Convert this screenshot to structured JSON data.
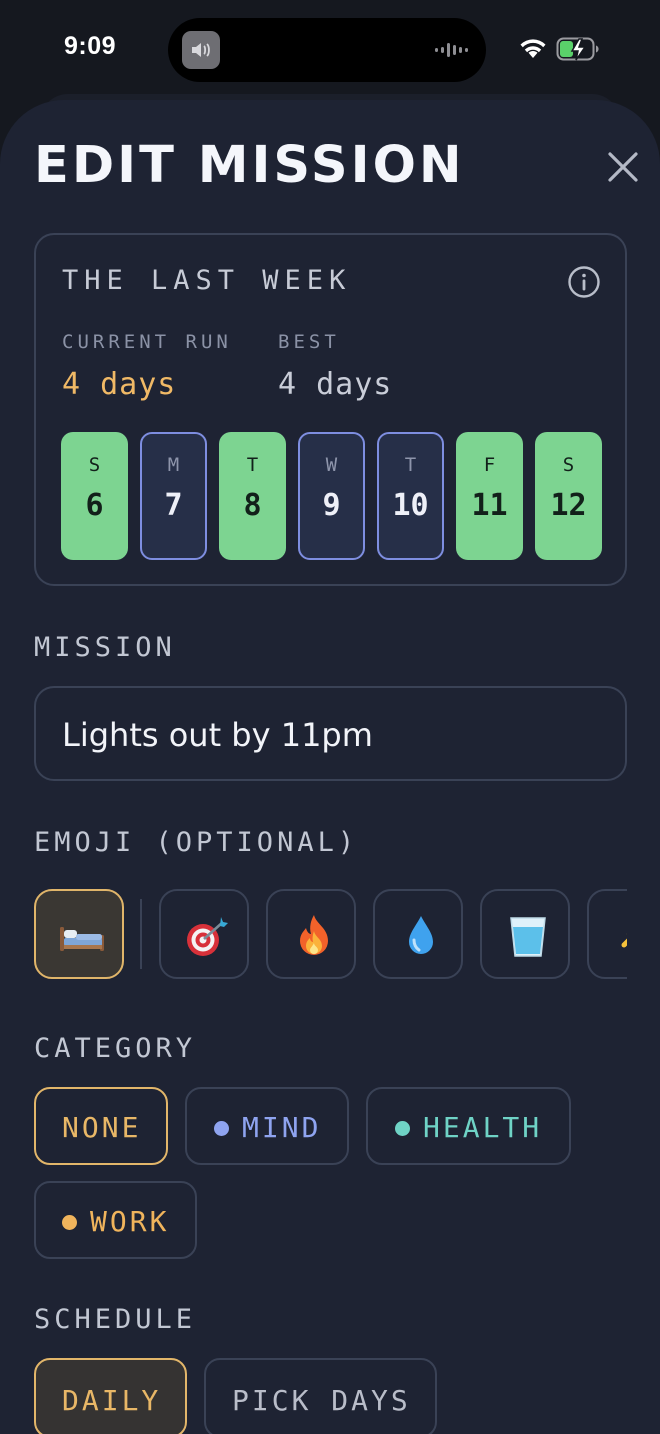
{
  "status_bar": {
    "time": "9:09"
  },
  "sheet": {
    "title": "EDIT MISSION"
  },
  "week": {
    "title": "THE LAST WEEK",
    "current_run_label": "CURRENT RUN",
    "current_run_value": "4 days",
    "best_label": "BEST",
    "best_value": "4 days",
    "days": [
      {
        "letter": "S",
        "number": "6",
        "done": true
      },
      {
        "letter": "M",
        "number": "7",
        "done": false
      },
      {
        "letter": "T",
        "number": "8",
        "done": true
      },
      {
        "letter": "W",
        "number": "9",
        "done": false
      },
      {
        "letter": "T",
        "number": "10",
        "done": false
      },
      {
        "letter": "F",
        "number": "11",
        "done": true
      },
      {
        "letter": "S",
        "number": "12",
        "done": true
      }
    ]
  },
  "mission": {
    "label": "MISSION",
    "value": "Lights out by 11pm"
  },
  "emoji": {
    "label": "EMOJI (OPTIONAL)",
    "selected": "bed",
    "options": [
      "bed",
      "direct-hit",
      "fire",
      "droplet",
      "glass-of-water",
      "person-running"
    ]
  },
  "category": {
    "label": "CATEGORY",
    "selected": "NONE",
    "options": [
      {
        "label": "NONE",
        "color": "#e8b767"
      },
      {
        "label": "MIND",
        "color": "#8fa4f0"
      },
      {
        "label": "HEALTH",
        "color": "#6fd3c6"
      },
      {
        "label": "WORK",
        "color": "#f0b45c"
      }
    ]
  },
  "schedule": {
    "label": "SCHEDULE",
    "selected": "DAILY",
    "options": [
      "DAILY",
      "PICK DAYS"
    ]
  },
  "colors": {
    "background": "#1e2333",
    "accent_gold": "#e8b767",
    "done_green": "#7dd491",
    "missed_border": "#7e8ee0"
  }
}
